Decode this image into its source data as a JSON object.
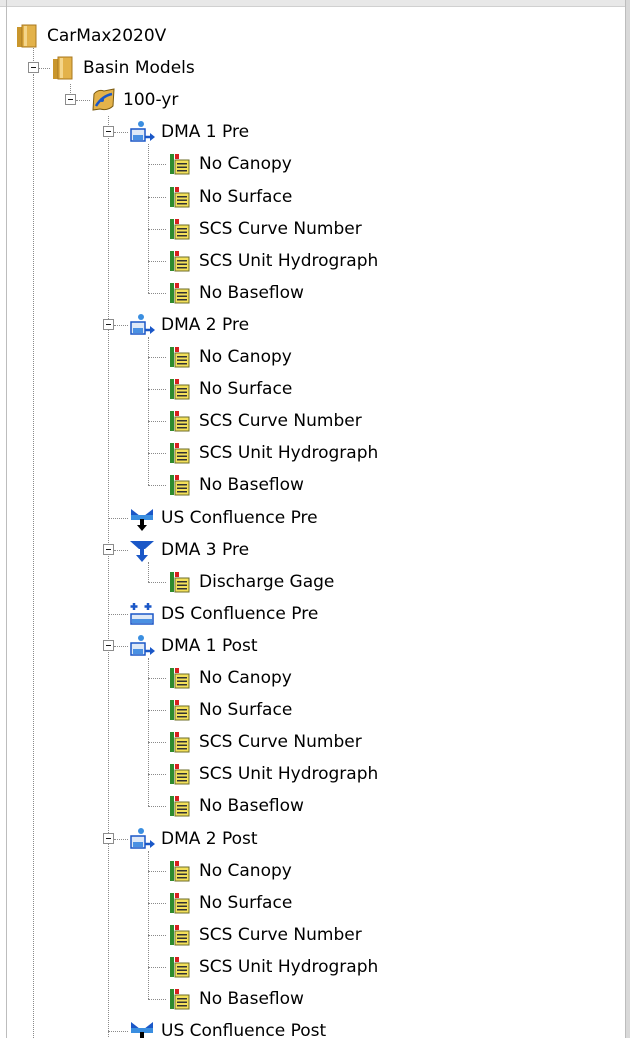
{
  "tree": {
    "root": {
      "label": "CarMax2020V",
      "icon": "folder-icon"
    },
    "basin_models": {
      "label": "Basin Models",
      "icon": "folder-icon"
    },
    "model": {
      "label": "100-yr",
      "icon": "basin-model-icon"
    },
    "nodes": [
      {
        "label": "DMA 1 Pre",
        "icon": "subbasin-icon",
        "children": [
          "No Canopy",
          "No Surface",
          "SCS Curve Number",
          "SCS Unit Hydrograph",
          "No Baseflow"
        ]
      },
      {
        "label": "DMA 2 Pre",
        "icon": "subbasin-icon",
        "children": [
          "No Canopy",
          "No Surface",
          "SCS Curve Number",
          "SCS Unit Hydrograph",
          "No Baseflow"
        ]
      },
      {
        "label": "US Confluence Pre",
        "icon": "junction-icon",
        "children": []
      },
      {
        "label": "DMA 3 Pre",
        "icon": "reach-icon",
        "children": [
          "Discharge Gage"
        ]
      },
      {
        "label": "DS Confluence Pre",
        "icon": "confluence-icon",
        "children": []
      },
      {
        "label": "DMA 1 Post",
        "icon": "subbasin-icon",
        "children": [
          "No Canopy",
          "No Surface",
          "SCS Curve Number",
          "SCS Unit Hydrograph",
          "No Baseflow"
        ]
      },
      {
        "label": "DMA 2 Post",
        "icon": "subbasin-icon",
        "children": [
          "No Canopy",
          "No Surface",
          "SCS Curve Number",
          "SCS Unit Hydrograph",
          "No Baseflow"
        ]
      },
      {
        "label": "US Confluence Post",
        "icon": "junction-icon",
        "children": []
      }
    ]
  },
  "colors": {
    "folder": "#e3b24a",
    "method_green": "#2e8b2e",
    "method_red": "#d62020",
    "method_yellow": "#f3e05a",
    "element_blue": "#1a57c7"
  }
}
